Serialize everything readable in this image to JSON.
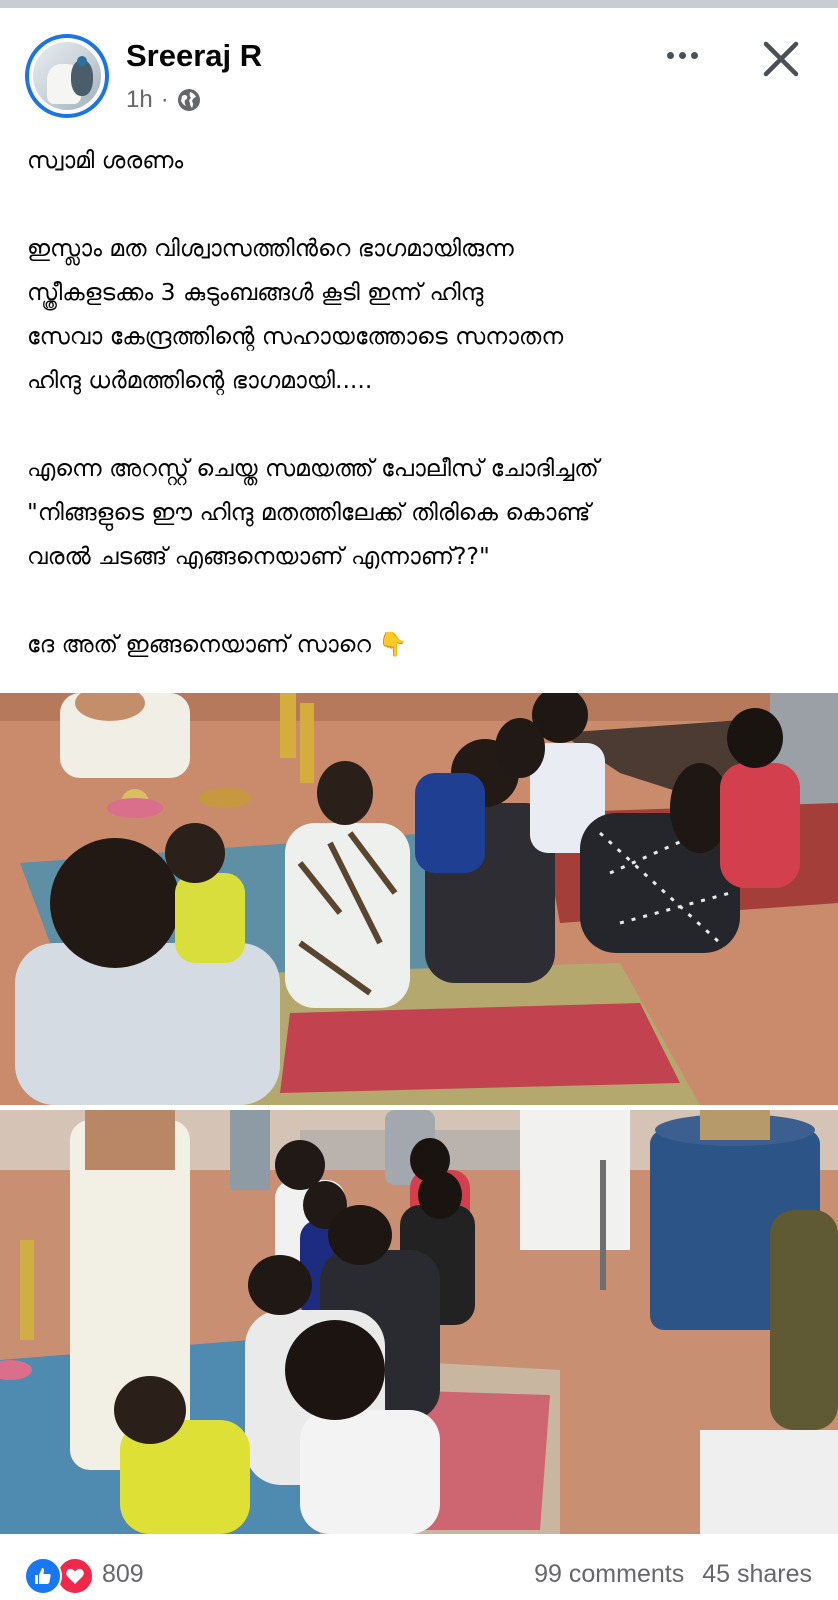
{
  "post": {
    "author": "Sreeraj R",
    "time": "1h",
    "separator": "·",
    "privacy_icon": "globe-icon",
    "menu_icon": "more-horizontal-icon",
    "close_icon": "close-icon",
    "paragraphs": [
      "സ്വാമി ശരണം",
      "ഇസ്ലാം മത വിശ്വാസത്തിൻറെ ഭാഗമായിരുന്ന\nസ്ത്രീകളടക്കം 3 കുടുംബങ്ങൾ കൂടി ഇന്ന് ഹിന്ദു\nസേവാ കേന്ദ്രത്തിന്റെ സഹായത്തോടെ സനാതന\nഹിന്ദു ധർമത്തിന്റെ ഭാഗമായി.....",
      "എന്നെ അറസ്റ്റ് ചെയ്ത സമയത്ത് പോലീസ് ചോദിച്ചത്\n\"നിങ്ങളുടെ ഈ ഹിന്ദു മതത്തിലേക്ക് തിരികെ കൊണ്ട്\nവരൽ ചടങ്ങ് എങ്ങനെയാണ് എന്നാണ്??\"",
      "ദേ അത് ഇങ്ങനെയാണ് സാറെ 👇"
    ]
  },
  "reactions": {
    "icons": [
      "like-icon",
      "love-icon"
    ],
    "count": "809",
    "comments": "99 comments",
    "shares": "45 shares"
  },
  "colors": {
    "accent": "#1877f2",
    "love": "#f0284a",
    "secondary_text": "#65676b"
  }
}
